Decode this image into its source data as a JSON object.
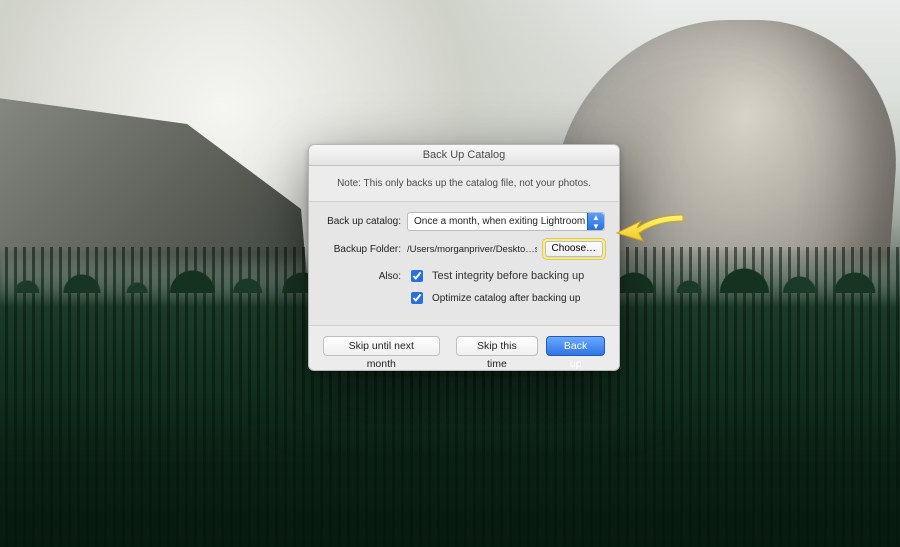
{
  "dialog": {
    "title": "Back Up Catalog",
    "note": "Note: This only backs up the catalog file, not your photos.",
    "backup_catalog_label": "Back up catalog:",
    "backup_catalog_value": "Once a month, when exiting Lightroom",
    "backup_folder_label": "Backup Folder:",
    "backup_folder_path": "/Users/morganpriver/Deskto…s/Template LRCAT/Backups",
    "choose_label": "Choose…",
    "also_label": "Also:",
    "check_integrity_label": "Test integrity before backing up",
    "check_integrity_checked": true,
    "check_optimize_label": "Optimize catalog after backing up",
    "check_optimize_checked": true,
    "skip_until_label": "Skip until next month",
    "skip_this_label": "Skip this time",
    "backup_btn_label": "Back up"
  }
}
